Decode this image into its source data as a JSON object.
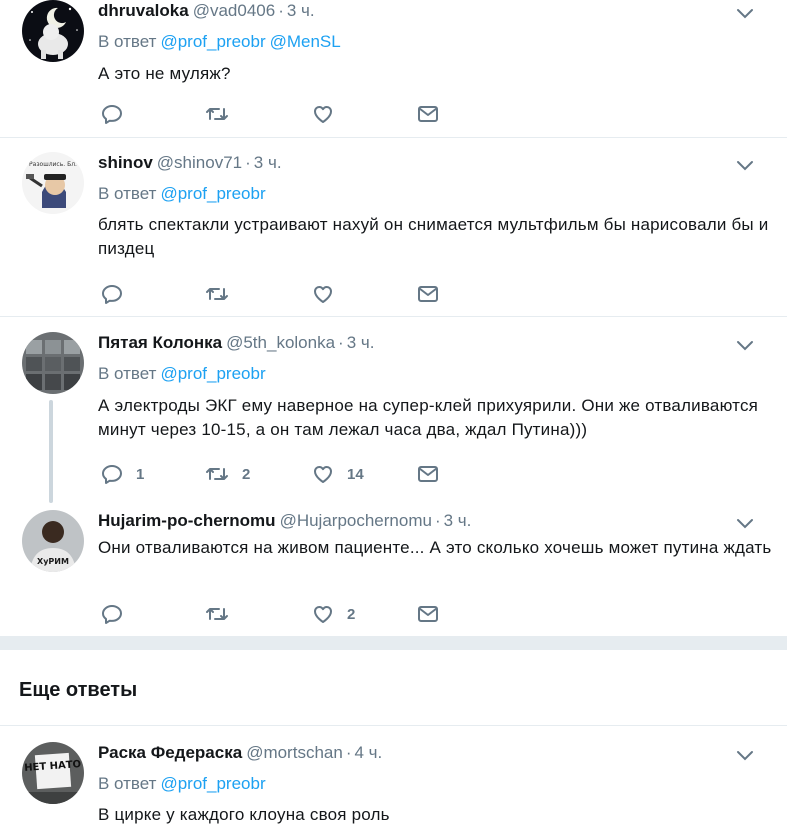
{
  "colors": {
    "link": "#1da1f2",
    "muted": "#657786",
    "text": "#14171a",
    "border": "#e6ecf0"
  },
  "tweets": [
    {
      "name": "dhruvaloka",
      "handle": "@vad0406",
      "time": "3 ч.",
      "reply_prefix": "В ответ",
      "reply_to": [
        "@prof_preobr",
        "@MenSL"
      ],
      "text": "А это не муляж?",
      "counts": {
        "reply": "",
        "retweet": "",
        "like": ""
      }
    },
    {
      "name": "shinov",
      "handle": "@shinov71",
      "time": "3 ч.",
      "reply_prefix": "В ответ",
      "reply_to": [
        "@prof_preobr"
      ],
      "text": "блять спектакли устраивают нахуй он снимается мультфильм бы нарисовали бы и пиздец",
      "avatar_caption": "Разошлись. Бл.",
      "counts": {
        "reply": "",
        "retweet": "",
        "like": ""
      }
    },
    {
      "name": "Пятая Колонка",
      "handle": "@5th_kolonka",
      "time": "3 ч.",
      "reply_prefix": "В ответ",
      "reply_to": [
        "@prof_preobr"
      ],
      "text": "А электроды ЭКГ ему наверное на супер-клей прихуярили. Они же отваливаются минут через 10-15, а он там лежал часа два, ждал Путина)))",
      "counts": {
        "reply": "1",
        "retweet": "2",
        "like": "14"
      }
    },
    {
      "name": "Hujarim-po-chernomu",
      "handle": "@Hujarpochernomu",
      "time": "3 ч.",
      "text": "Они отваливаются на живом пациенте... А это сколько хочешь может путина ждать",
      "avatar_caption": "ХуРИМ",
      "counts": {
        "reply": "",
        "retweet": "",
        "like": "2"
      }
    }
  ],
  "more_replies": {
    "title": "Еще ответы",
    "tweet": {
      "name": "Раска Федераска",
      "handle": "@mortschan",
      "time": "4 ч.",
      "reply_prefix": "В ответ",
      "reply_to": [
        "@prof_preobr"
      ],
      "text": "В цирке у каждого клоуна своя роль",
      "avatar_caption": "НЕТ НАТО"
    }
  },
  "icons": [
    "reply-icon",
    "retweet-icon",
    "like-icon",
    "message-icon",
    "chevron-down-icon"
  ]
}
